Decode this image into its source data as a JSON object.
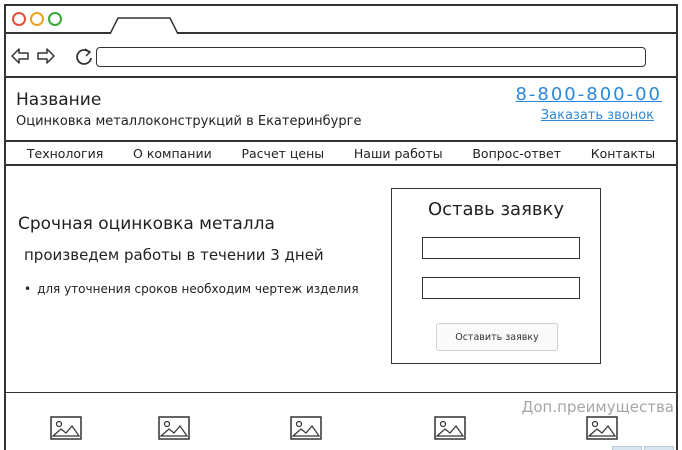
{
  "header": {
    "site_name": "Название",
    "site_desc": "Оцинковка металлоконструкций в Екатеринбурге",
    "phone": "8-800-800-00",
    "callback": "Заказать звонок"
  },
  "menu": {
    "items": [
      "Технология",
      "О компании",
      "Расчет цены",
      "Наши работы",
      "Вопрос-ответ",
      "Контакты"
    ]
  },
  "hero": {
    "title": "Срочная оцинковка металла",
    "subtitle": "произведем работы в течении 3 дней",
    "note": "для уточнения сроков необходим чертеж изделия"
  },
  "form": {
    "title": "Оставь заявку",
    "field1_value": "",
    "field2_value": "",
    "submit_label": "Оставить заявку"
  },
  "advantages": {
    "label": "Доп.преимущества"
  },
  "colors": {
    "link": "#2b88d8",
    "muted": "#a6a6a6",
    "stroke": "#333333"
  },
  "icons": {
    "close": "close-dot-icon",
    "minimize": "minimize-dot-icon",
    "maximize": "maximize-dot-icon",
    "back": "arrow-left-icon",
    "forward": "arrow-right-icon",
    "reload": "reload-icon",
    "image": "image-placeholder-icon"
  }
}
